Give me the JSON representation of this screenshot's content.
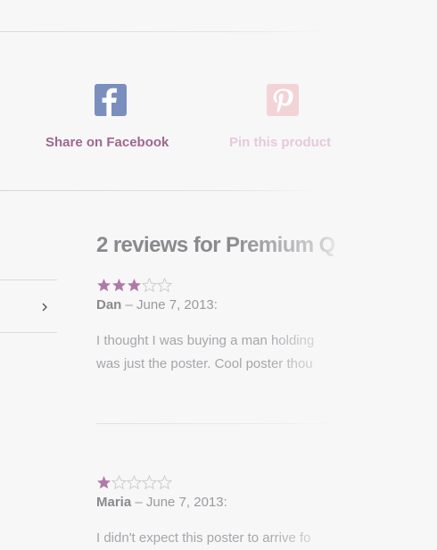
{
  "share": {
    "facebook": {
      "label": "Share on Facebook",
      "icon": "facebook-icon",
      "color": "#7a8fbd",
      "label_color": "#a0678f"
    },
    "pinterest": {
      "label": "Pin this product",
      "icon": "pinterest-icon",
      "color": "#f2d3d6",
      "label_color": "#e6c9dc"
    }
  },
  "reviews": {
    "title": "2 reviews for Premium Q",
    "star_color": "#b07aa8",
    "items": [
      {
        "rating": 3,
        "max": 5,
        "author": "Dan",
        "separator": " – ",
        "date": "June 7, 2013:",
        "lines": [
          "I thought I was buying a man holding",
          "was just the poster. Cool poster thou"
        ]
      },
      {
        "rating": 1,
        "max": 5,
        "author": "Maria",
        "separator": " – ",
        "date": "June 7, 2013:",
        "lines": [
          "I didn't expect this poster to arrive fo"
        ]
      }
    ]
  },
  "sidebar": {
    "chevron_icon": "chevron-right-icon"
  }
}
